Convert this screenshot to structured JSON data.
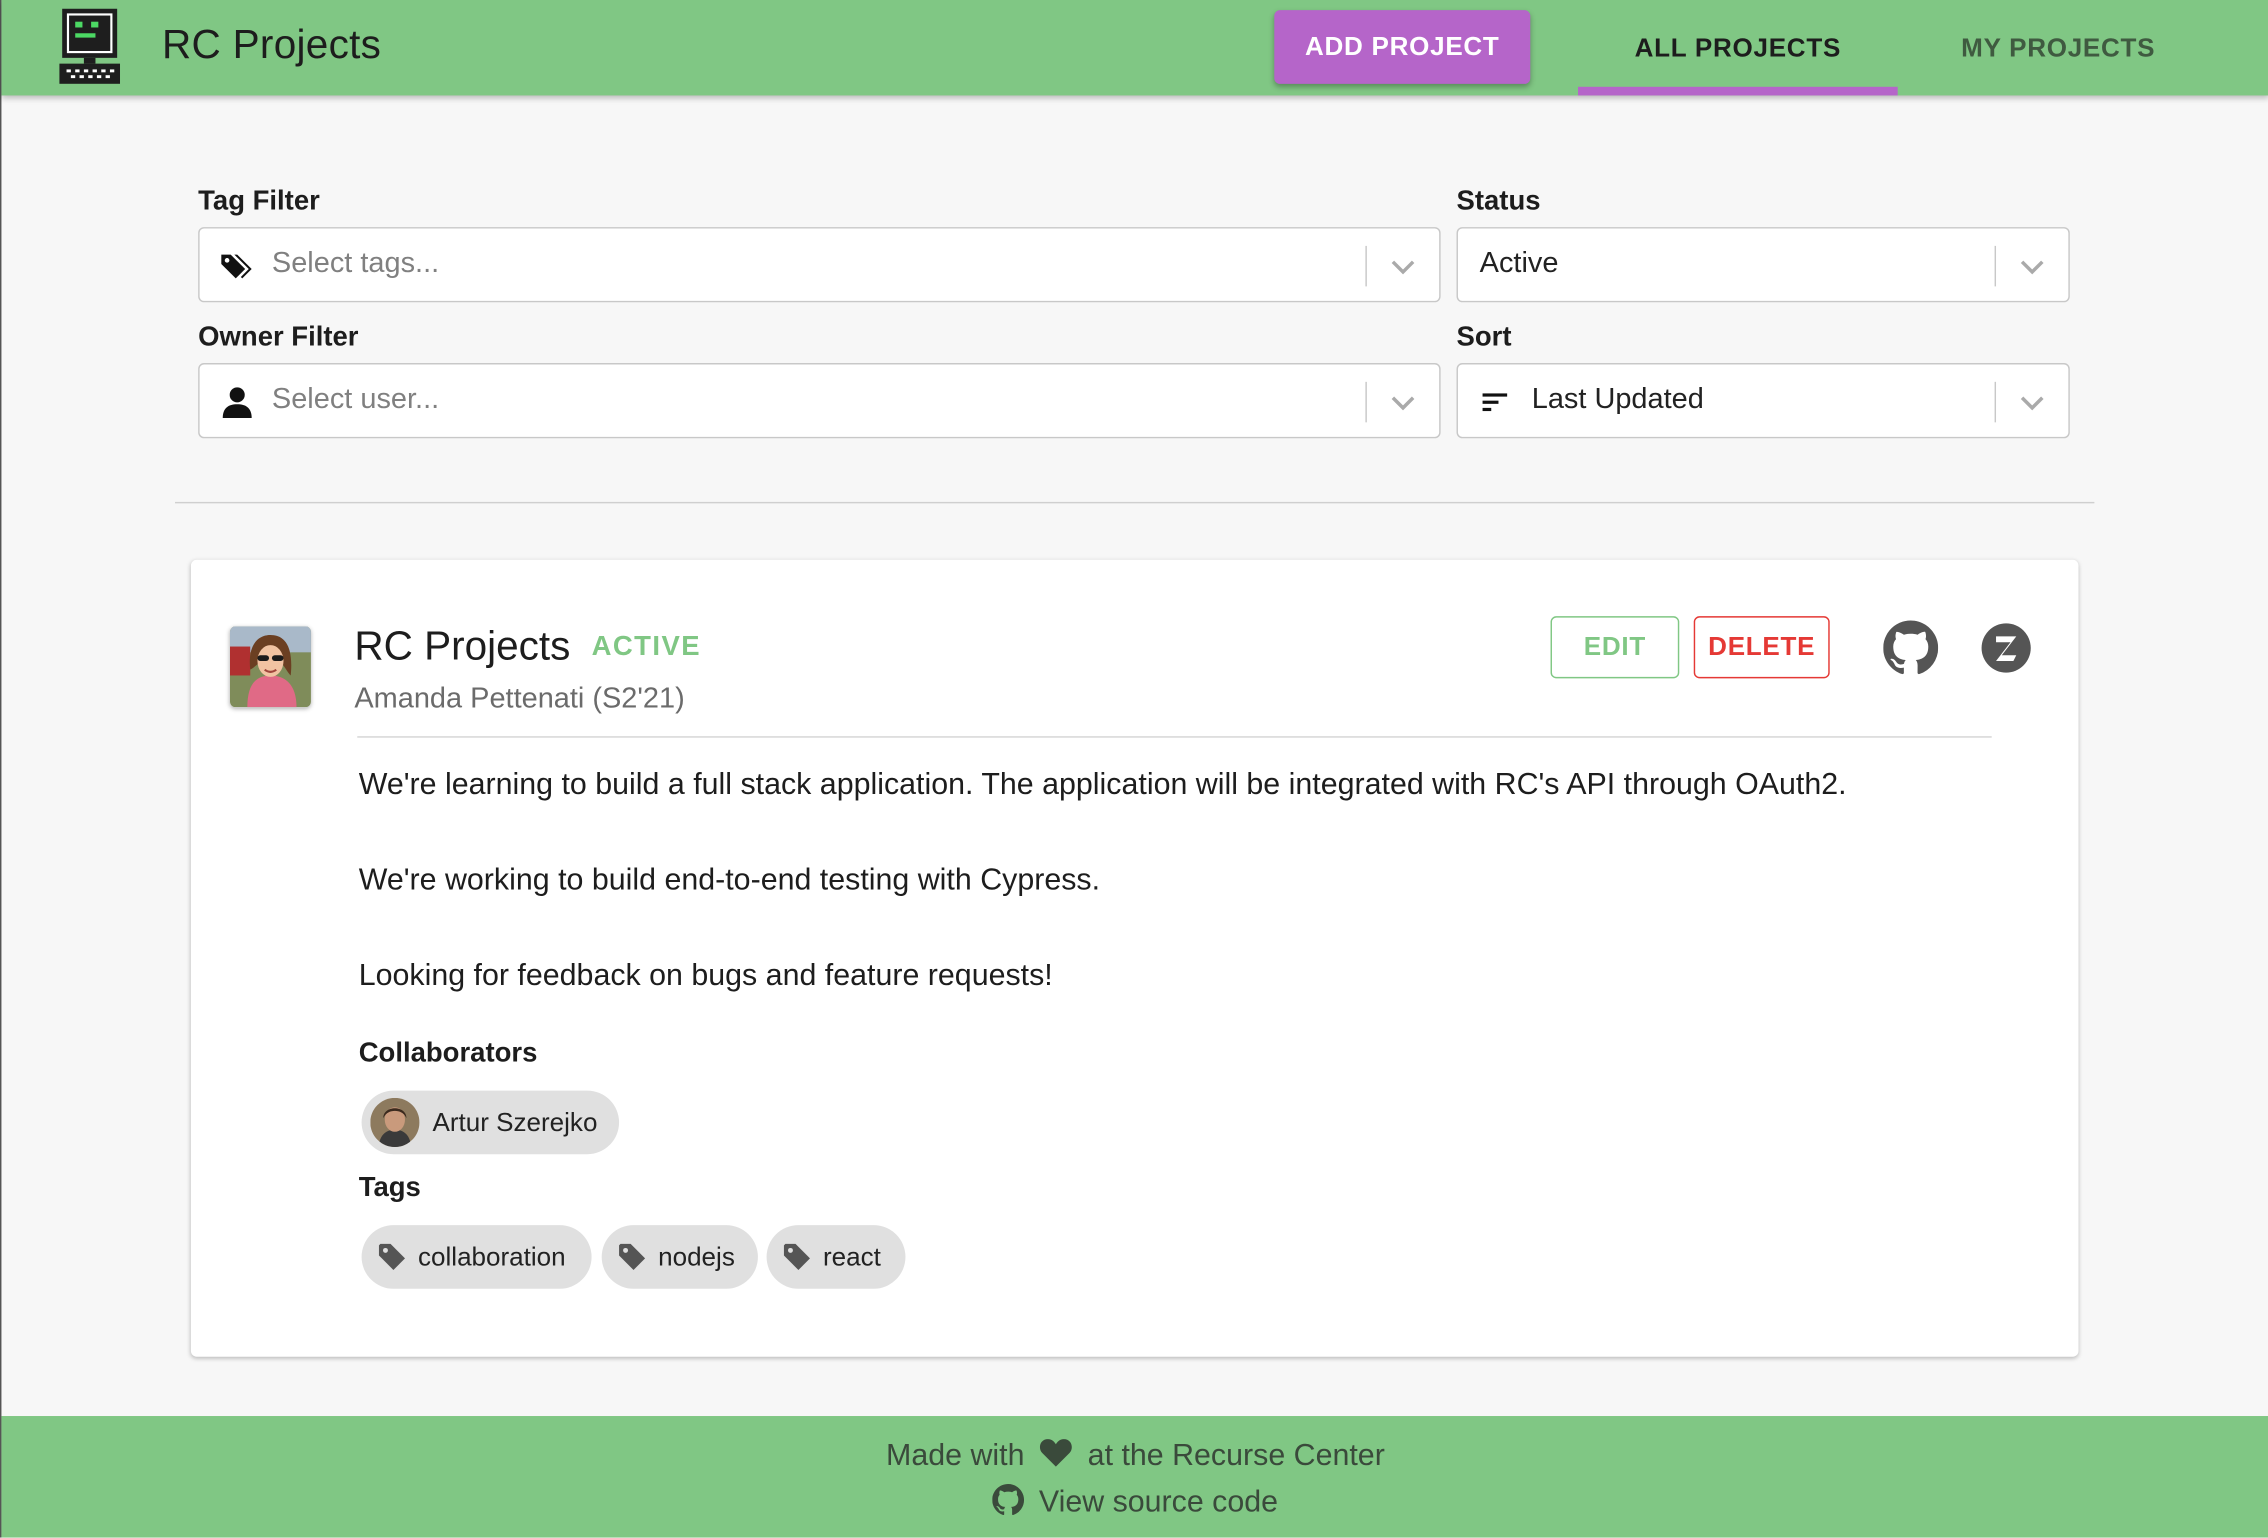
{
  "app": {
    "title": "RC Projects"
  },
  "header": {
    "add_project_label": "ADD PROJECT",
    "tabs": [
      {
        "label": "ALL PROJECTS",
        "active": true
      },
      {
        "label": "MY PROJECTS",
        "active": false
      }
    ]
  },
  "filters": {
    "tag": {
      "label": "Tag Filter",
      "placeholder": "Select tags...",
      "icon": "tags-icon"
    },
    "status": {
      "label": "Status",
      "value": "Active"
    },
    "owner": {
      "label": "Owner Filter",
      "placeholder": "Select user...",
      "icon": "user-icon"
    },
    "sort": {
      "label": "Sort",
      "value": "Last Updated",
      "icon": "sort-icon"
    }
  },
  "project": {
    "title": "RC Projects",
    "status": "ACTIVE",
    "owner": "Amanda Pettenati (S2'21)",
    "edit_label": "EDIT",
    "delete_label": "DELETE",
    "links": [
      "github-icon",
      "zulip-icon"
    ],
    "description": [
      "We're learning to build a full stack application. The application will be integrated with RC's API through OAuth2.",
      "We're working to build end-to-end testing with Cypress.",
      "Looking for feedback on bugs and feature requests!"
    ],
    "collaborators_label": "Collaborators",
    "collaborators": [
      {
        "name": "Artur Szerejko"
      }
    ],
    "tags_label": "Tags",
    "tags": [
      "collaboration",
      "nodejs",
      "react"
    ]
  },
  "footer": {
    "made_with_prefix": "Made with",
    "made_with_suffix": "at the Recurse Center",
    "source_label": "View source code"
  },
  "colors": {
    "header_green": "#80c784",
    "accent_purple": "#b565c9",
    "active_green": "#80c784",
    "delete_red": "#e53935"
  }
}
